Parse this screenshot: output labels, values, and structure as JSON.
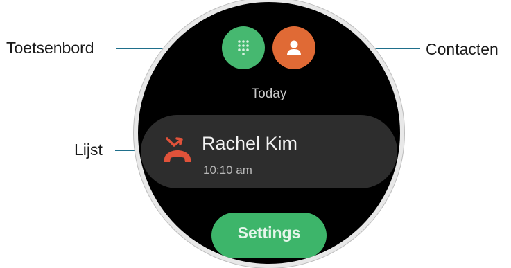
{
  "callouts": {
    "keypad": "Toetsenbord",
    "contacts": "Contacten",
    "list": "Lijst"
  },
  "screen": {
    "date_header": "Today",
    "call_entry": {
      "name": "Rachel Kim",
      "time": "10:10 am",
      "icon": "missed-call-icon"
    },
    "keypad_button_icon": "dialpad-icon",
    "contacts_button_icon": "person-icon",
    "settings_label": "Settings"
  },
  "colors": {
    "keypad_button": "#46b870",
    "contacts_button": "#e06a35",
    "settings_button": "#3db56a",
    "missed_call": "#e0523a",
    "callout_line": "#1f6f8b"
  }
}
